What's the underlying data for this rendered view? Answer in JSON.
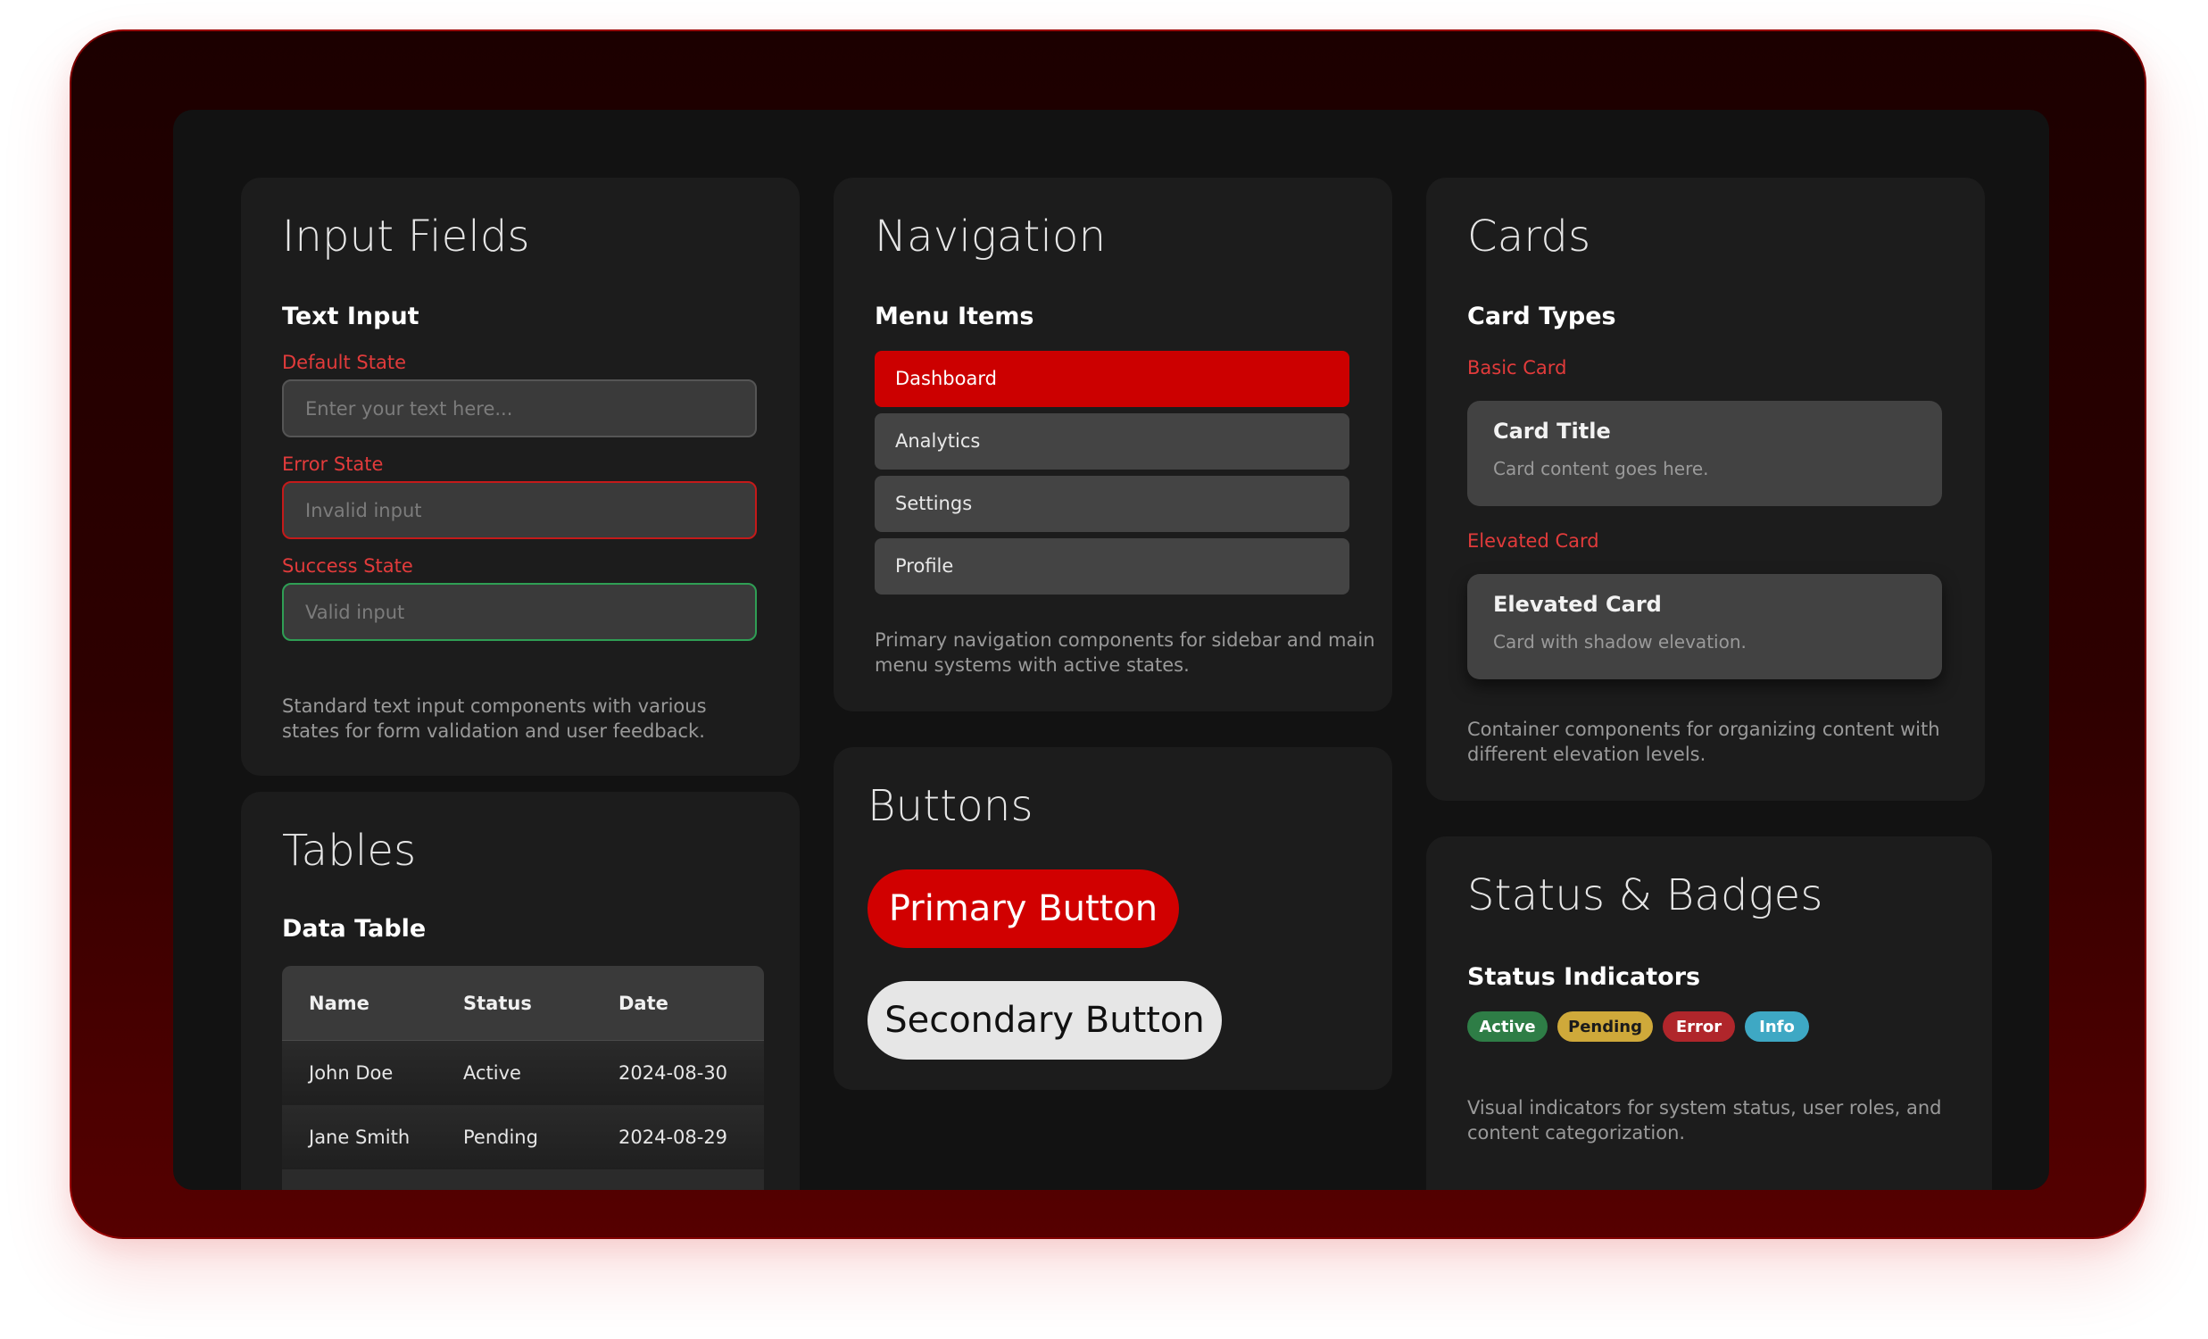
{
  "input_fields": {
    "title": "Input Fields",
    "subtitle": "Text Input",
    "default_label": "Default State",
    "default_placeholder": "Enter your text here...",
    "error_label": "Error State",
    "error_placeholder": "Invalid input",
    "success_label": "Success State",
    "success_placeholder": "Valid input",
    "description": "Standard text input components with various states for form validation and user feedback."
  },
  "navigation": {
    "title": "Navigation",
    "subtitle": "Menu Items",
    "items": [
      {
        "label": "Dashboard",
        "active": true
      },
      {
        "label": "Analytics",
        "active": false
      },
      {
        "label": "Settings",
        "active": false
      },
      {
        "label": "Profile",
        "active": false
      }
    ],
    "description": "Primary navigation components for sidebar and main menu systems with active states."
  },
  "cards": {
    "title": "Cards",
    "subtitle": "Card Types",
    "basic_label": "Basic Card",
    "basic_card": {
      "title": "Card Title",
      "body": "Card content goes here."
    },
    "elevated_label": "Elevated Card",
    "elevated_card": {
      "title": "Elevated Card",
      "body": "Card with shadow elevation."
    },
    "description": "Container components for organizing content with different elevation levels."
  },
  "tables": {
    "title": "Tables",
    "subtitle": "Data Table",
    "columns": [
      "Name",
      "Status",
      "Date"
    ],
    "rows": [
      [
        "John Doe",
        "Active",
        "2024-08-30"
      ],
      [
        "Jane Smith",
        "Pending",
        "2024-08-29"
      ]
    ]
  },
  "buttons": {
    "title": "Buttons",
    "primary_label": "Primary Button",
    "secondary_label": "Secondary Button"
  },
  "status": {
    "title": "Status & Badges",
    "subtitle": "Status Indicators",
    "badges": [
      {
        "label": "Active",
        "color": "#2e7d46"
      },
      {
        "label": "Pending",
        "color": "#cfa93a"
      },
      {
        "label": "Error",
        "color": "#b0262b"
      },
      {
        "label": "Info",
        "color": "#3ea8c4"
      }
    ],
    "description": "Visual indicators for system status, user roles, and content categorization."
  },
  "colors": {
    "accent": "#cc0000",
    "panel": "#1c1c1c",
    "screen": "#121212"
  }
}
